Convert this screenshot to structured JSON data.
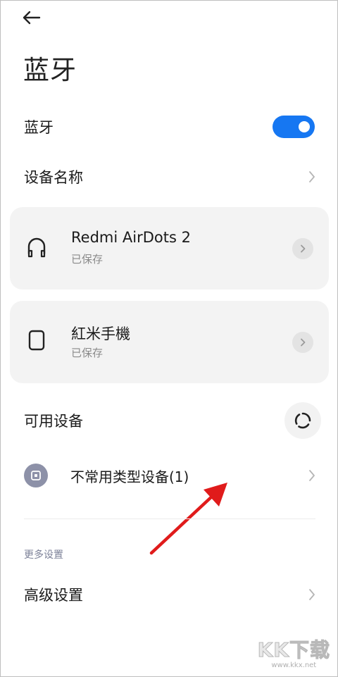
{
  "header": {
    "back_icon": "arrow-left-icon",
    "title": "蓝牙"
  },
  "bluetooth_toggle": {
    "label": "蓝牙",
    "on": true,
    "color": "#1677f2"
  },
  "device_name_row": {
    "label": "设备名称"
  },
  "saved_devices": [
    {
      "name": "Redmi AirDots 2",
      "status": "已保存",
      "icon": "headphones-icon"
    },
    {
      "name": "紅米手機",
      "status": "已保存",
      "icon": "phone-icon"
    }
  ],
  "available": {
    "label": "可用设备",
    "refresh_icon": "refresh-icon"
  },
  "uncommon_devices": {
    "label": "不常用类型设备(1)",
    "icon": "device-type-icon"
  },
  "more_settings": {
    "section_label": "更多设置",
    "advanced_label": "高级设置"
  },
  "watermark": {
    "logo": "KK下载",
    "url": "www.kkx.net"
  },
  "annotation": {
    "arrow_color": "#e01b1b"
  }
}
